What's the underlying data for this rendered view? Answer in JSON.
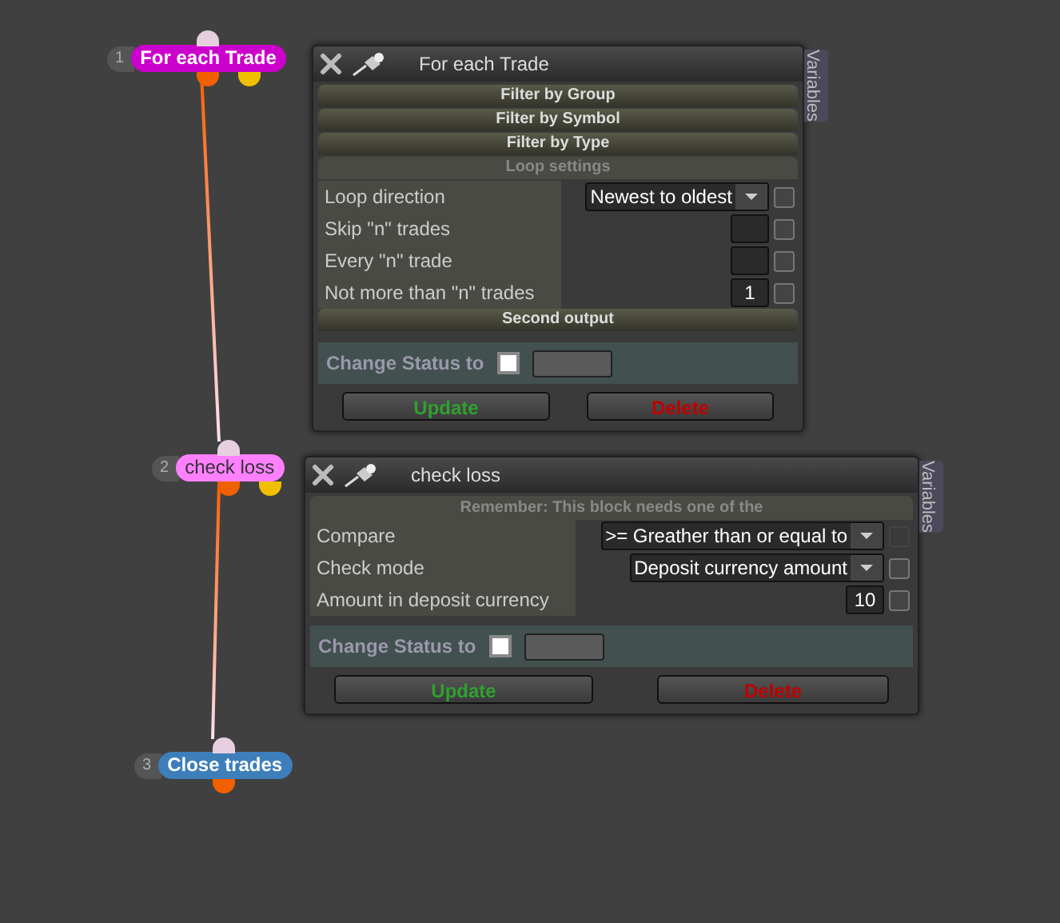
{
  "nodes": [
    {
      "number": "1",
      "label": "For each Trade",
      "color": "#cc00cc",
      "second_output": true
    },
    {
      "number": "2",
      "label": "check loss",
      "color": "#ff80ff",
      "second_output": true
    },
    {
      "number": "3",
      "label": "Close trades",
      "color": "#3d7ebb",
      "second_output": false
    }
  ],
  "panels": [
    {
      "title": "For each Trade",
      "side_tab": "Variables",
      "items": [
        {
          "kind": "section",
          "label": "Filter by Group",
          "expanded": false
        },
        {
          "kind": "section",
          "label": "Filter by Symbol",
          "expanded": false
        },
        {
          "kind": "section",
          "label": "Filter by Type",
          "expanded": false
        },
        {
          "kind": "section",
          "label": "Loop settings",
          "expanded": true
        },
        {
          "kind": "select",
          "label": "Loop direction",
          "value": "Newest to oldest",
          "checked": false,
          "disabled": false
        },
        {
          "kind": "number",
          "label": "Skip \"n\" trades",
          "value": "",
          "checked": false,
          "disabled": false
        },
        {
          "kind": "number",
          "label": "Every \"n\" trade",
          "value": "",
          "checked": false,
          "disabled": false
        },
        {
          "kind": "number",
          "label": "Not more than \"n\" trades",
          "value": "1",
          "checked": false,
          "disabled": false
        },
        {
          "kind": "section",
          "label": "Second output",
          "expanded": false
        }
      ],
      "status": {
        "label": "Change Status to",
        "checked": false
      },
      "buttons": [
        {
          "kind": "update",
          "label": "Update"
        },
        {
          "kind": "delete",
          "label": "Delete"
        }
      ]
    },
    {
      "title": "check loss",
      "side_tab": "Variables",
      "items": [
        {
          "kind": "notice",
          "label": "Remember: This block needs one of the"
        },
        {
          "kind": "select",
          "label": "Compare",
          "value": ">= Greather than or equal to",
          "checked": false,
          "disabled": true
        },
        {
          "kind": "select",
          "label": "Check mode",
          "value": "Deposit currency amount",
          "checked": false,
          "disabled": false
        },
        {
          "kind": "number",
          "label": "Amount in deposit currency",
          "value": "10",
          "checked": false,
          "disabled": false
        }
      ],
      "status": {
        "label": "Change Status to",
        "checked": false
      },
      "buttons": [
        {
          "kind": "update",
          "label": "Update"
        },
        {
          "kind": "delete",
          "label": "Delete"
        }
      ]
    }
  ]
}
